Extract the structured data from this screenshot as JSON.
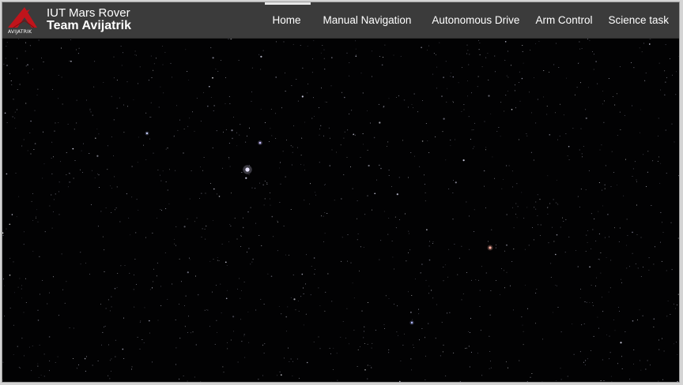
{
  "brand": {
    "logo_text": "AVIJATRIK",
    "title_line1": "IUT Mars Rover",
    "title_line2": "Team Avijatrik"
  },
  "nav": {
    "items": [
      {
        "label": "Home",
        "active": true
      },
      {
        "label": "Manual Navigation",
        "active": false
      },
      {
        "label": "Autonomous Drive",
        "active": false
      },
      {
        "label": "Arm Control",
        "active": false
      },
      {
        "label": "Science task",
        "active": false
      }
    ]
  },
  "colors": {
    "navbar_bg": "#3b3b3b",
    "logo_red": "#c0141b",
    "sky": "#020203"
  }
}
